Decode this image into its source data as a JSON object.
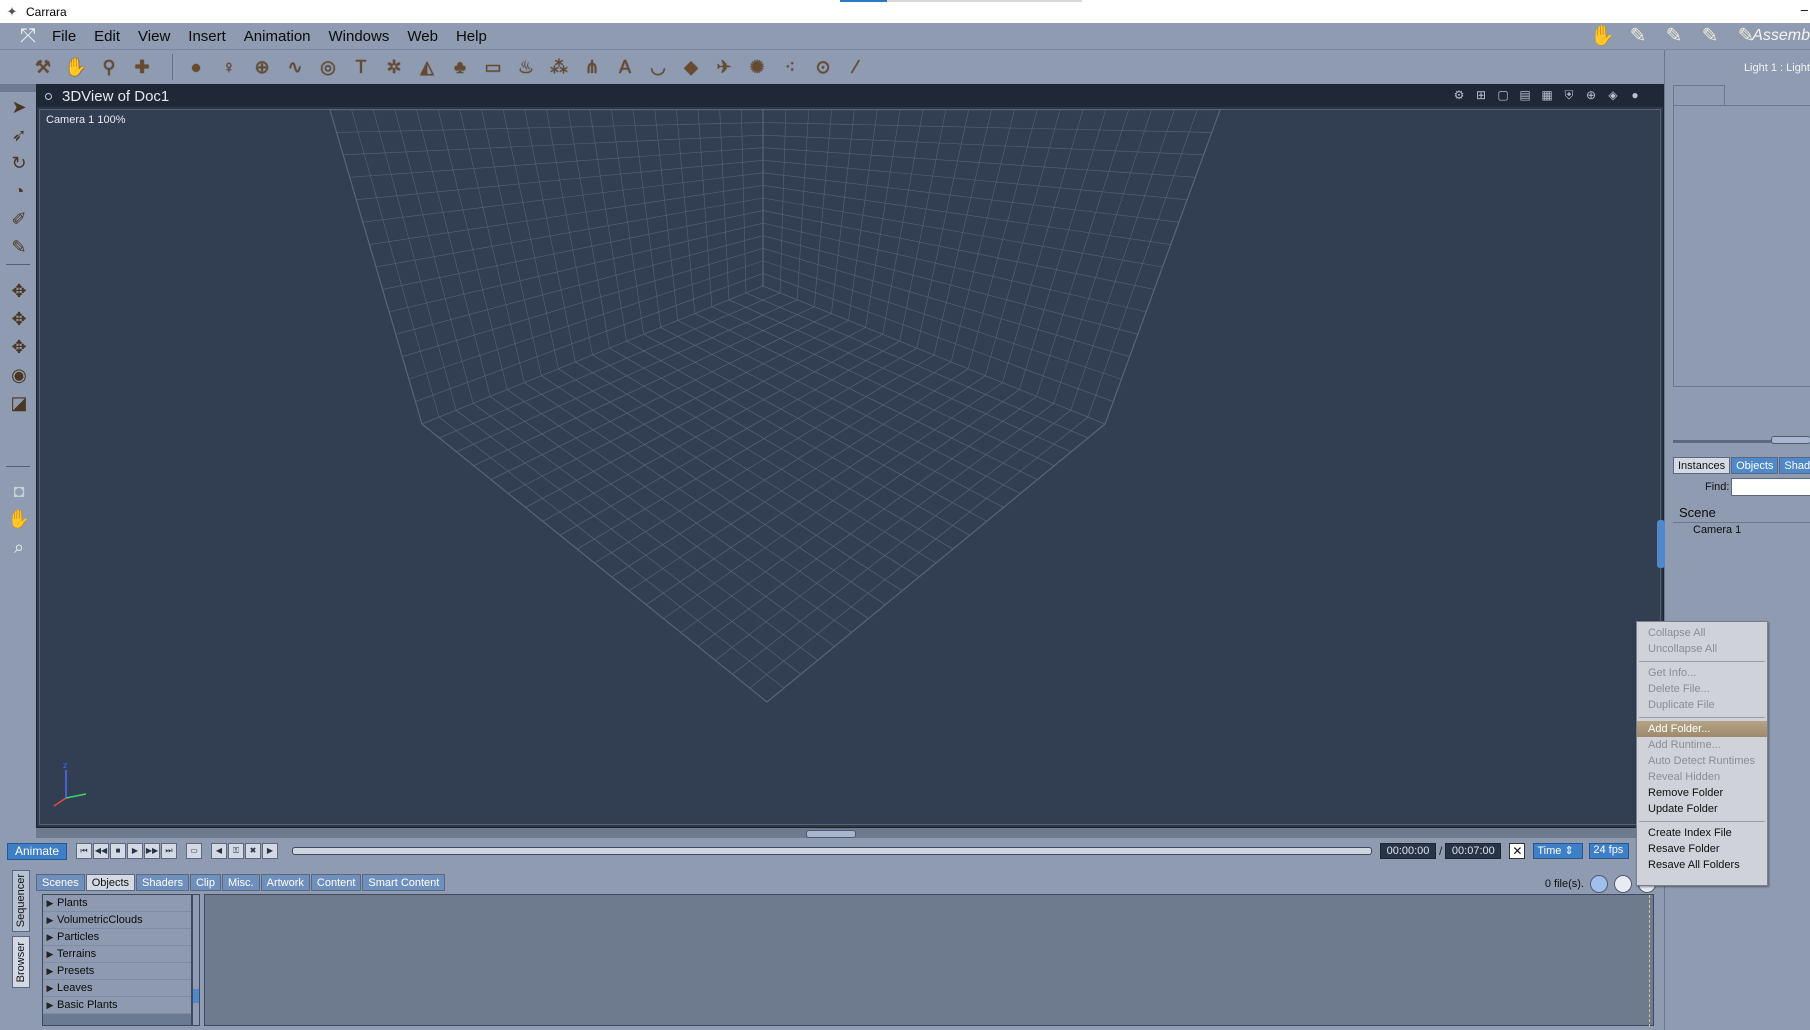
{
  "window": {
    "title": "Carrara"
  },
  "menubar": {
    "items": [
      "File",
      "Edit",
      "View",
      "Insert",
      "Animation",
      "Windows",
      "Web",
      "Help"
    ],
    "room_label": "Assemb"
  },
  "view": {
    "title": "3DView of Doc1",
    "camera_label": "Camera 1 100%"
  },
  "timeline": {
    "animate_label": "Animate",
    "current_time": "00:00:00",
    "separator": "/",
    "end_time": "00:07:00",
    "mode": "Time",
    "fps": "24 fps"
  },
  "right_panel": {
    "light_label": "Light 1 : Light",
    "tabs": [
      "Instances",
      "Objects",
      "Shade"
    ],
    "find_label": "Find:",
    "find_value": "",
    "scene_title": "Scene",
    "scene_items": [
      "Camera 1"
    ]
  },
  "browser": {
    "side_tabs": [
      "Sequencer",
      "Browser"
    ],
    "tabs": [
      "Scenes",
      "Objects",
      "Shaders",
      "Clip",
      "Misc.",
      "Artwork",
      "Content",
      "Smart Content"
    ],
    "active_tab": "Objects",
    "file_count": "0 file(s).",
    "tree": [
      "Plants",
      "VolumetricClouds",
      "Particles",
      "Terrains",
      "Presets",
      "Leaves",
      "Basic Plants"
    ]
  },
  "context_menu": {
    "groups": [
      [
        {
          "label": "Collapse All",
          "enabled": false
        },
        {
          "label": "Uncollapse All",
          "enabled": false
        }
      ],
      [
        {
          "label": "Get Info...",
          "enabled": false
        },
        {
          "label": "Delete File...",
          "enabled": false
        },
        {
          "label": "Duplicate File",
          "enabled": false
        }
      ],
      [
        {
          "label": "Add Folder...",
          "enabled": true,
          "highlighted": true
        },
        {
          "label": "Add Runtime...",
          "enabled": false
        },
        {
          "label": "Auto Detect Runtimes",
          "enabled": false
        },
        {
          "label": "Reveal Hidden",
          "enabled": false
        },
        {
          "label": "Remove Folder",
          "enabled": true
        },
        {
          "label": "Update Folder",
          "enabled": true
        }
      ],
      [
        {
          "label": "Create Index File",
          "enabled": true
        },
        {
          "label": "Resave Folder",
          "enabled": true
        },
        {
          "label": "Resave All Folders",
          "enabled": true
        }
      ]
    ]
  },
  "colors": {
    "ui_background": "#8f9bb0",
    "viewport_background": "#323e51",
    "accent_blue": "#3f7fc7",
    "menu_highlight": "#a89476"
  }
}
